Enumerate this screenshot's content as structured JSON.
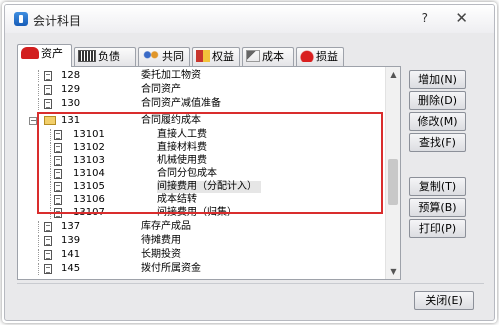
{
  "window": {
    "title": "会计科目",
    "help": "?",
    "close": "✕"
  },
  "tabs": [
    {
      "label": "资产",
      "icon": "car-icon",
      "active": true
    },
    {
      "label": "负债",
      "icon": "card-icon",
      "active": false
    },
    {
      "label": "共同",
      "icon": "people-icon",
      "active": false
    },
    {
      "label": "权益",
      "icon": "flag-icon",
      "active": false
    },
    {
      "label": "成本",
      "icon": "tool-icon",
      "active": false
    },
    {
      "label": "损益",
      "icon": "apple-icon",
      "active": false
    }
  ],
  "accounts": [
    {
      "code": "128",
      "name": "委托加工物资"
    },
    {
      "code": "129",
      "name": "合同资产"
    },
    {
      "code": "130",
      "name": "合同资产减值准备"
    },
    {
      "code": "131",
      "name": "合同履约成本",
      "expander": "−"
    },
    {
      "code": "13101",
      "name": "直接人工费"
    },
    {
      "code": "13102",
      "name": "直接材料费"
    },
    {
      "code": "13103",
      "name": "机械使用费"
    },
    {
      "code": "13104",
      "name": "合同分包成本"
    },
    {
      "code": "13105",
      "name": "间接费用（分配计入）"
    },
    {
      "code": "13106",
      "name": "成本结转"
    },
    {
      "code": "13107",
      "name": "间接费用（归集）"
    },
    {
      "code": "137",
      "name": "库存产成品"
    },
    {
      "code": "139",
      "name": "待摊费用"
    },
    {
      "code": "141",
      "name": "长期投资"
    },
    {
      "code": "145",
      "name": "拨付所属资金"
    }
  ],
  "buttons": {
    "add": "增加(N)",
    "delete": "删除(D)",
    "modify": "修改(M)",
    "find": "查找(F)",
    "copy": "复制(T)",
    "budget": "预算(B)",
    "print": "打印(P)",
    "close": "关闭(E)"
  },
  "scrollbar": {
    "up": "▲",
    "down": "▼"
  },
  "colors": {
    "highlight_border": "#d92d2d",
    "folder": "#f2cf6a"
  }
}
